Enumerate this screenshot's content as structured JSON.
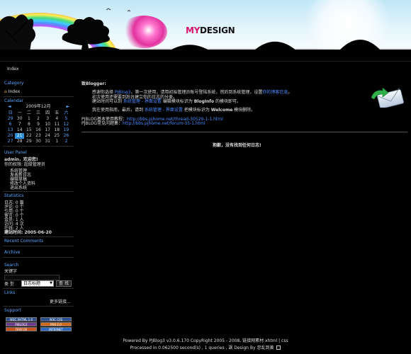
{
  "logo": {
    "part1": "MY",
    "part2": "DESIGN"
  },
  "nav": {
    "index": "Index"
  },
  "sidebar": {
    "category_title": "Category",
    "category_index": "Index",
    "calendar_title": "Calendar",
    "calendar": {
      "month": "2009年12月",
      "prev": "◄",
      "next": "►",
      "weekdays": [
        "日",
        "一",
        "二",
        "三",
        "四",
        "五",
        "六"
      ],
      "weeks": [
        [
          "29",
          "30",
          "1",
          "2",
          "3",
          "4",
          "5"
        ],
        [
          "6",
          "7",
          "8",
          "9",
          "10",
          "11",
          "12"
        ],
        [
          "13",
          "14",
          "15",
          "16",
          "17",
          "18",
          "19"
        ],
        [
          "20",
          "21",
          "22",
          "23",
          "24",
          "25",
          "26"
        ],
        [
          "27",
          "28",
          "29",
          "30",
          "31",
          "1",
          "2"
        ]
      ],
      "today": "21"
    },
    "userpanel_title": "User Panel",
    "user_greeting": "admin，欢迎您!",
    "user_role": "你的权限: 超级管理员",
    "user_links": [
      "系统管理",
      "发表新日志",
      "编辑草稿",
      "修改个人资料",
      "退出系统"
    ],
    "statistics_title": "Statistics",
    "stats": [
      "日志: 0 篇",
      "评论: 0 个",
      "引用: 0 个",
      "留言: 0 个",
      "会员: 1 人",
      "访问: 4 次",
      "在线: 2 人",
      "建站时间: 2005-06-20"
    ],
    "recent_comments_title": "Recent Comments",
    "archive_title": "Archive",
    "search_title": "Search",
    "search_label": "关键字",
    "search_type_label": "类 型",
    "search_select": "日志标题",
    "search_button": "查 找",
    "links_title": "Links",
    "links_more": "更多链接...",
    "support_title": "Support",
    "support_badges": [
      "W3C XHTML 1.0",
      "W3C CSS",
      "PJBLOG3",
      "RSS 2.0",
      "FIREFOX",
      "INTERNET EXPLORER"
    ]
  },
  "main": {
    "greeting": "致Blogger:",
    "p1_a": "感谢你选择 ",
    "p1_link": "PJBlog3",
    "p1_b": "，第一次使用，请用初始管理员账号登陆系统，然后到系统管理，设置",
    "p1_link2": "你的博客信息",
    "p1_c": "。",
    "p2": "初次使用还需要到后台建立你的日志的分类。",
    "p3_a": "建站时间可以到 ",
    "p3_link": "系统管理 - 界面设置",
    "p3_b": " 编辑模块标识为 ",
    "p3_bold": "BlogInfo",
    "p3_c": " 的模块即可。",
    "p4_a": "我在使用指南，最后，请到 ",
    "p4_link": "系统管理 - 界面设置",
    "p4_b": " 把模块标识为 ",
    "p4_bold": "Welcome",
    "p4_c": " 模块删除。",
    "tut_label": "PJBLOG基本使用教程：",
    "tut_url": "http://bbs.pjhome.net/thread-30529-1-1.html",
    "faq_label": "PJBLOG常见问题集：",
    "faq_url": "http://bbs.pjhome.net/forum-35-1.html",
    "empty_notice": "抱歉，没有找到任何日志!"
  },
  "footer": {
    "line1": "Powered By PJBlog3 v3.0.6.170 CopyRight 2005 - 2008, 链接网素材 xhtml | css",
    "line2": "Processed in 0.062500 second(s) , 1 queries , 飒 Design By 忽乱到黄"
  },
  "colors": {
    "accent": "#5aa6ff",
    "link": "#4d8cff",
    "today": "#2b8fd9",
    "logo_pink": "#d8146e"
  }
}
